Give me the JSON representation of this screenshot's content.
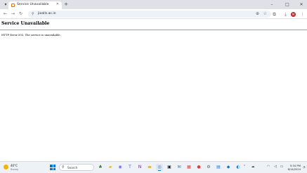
{
  "browser": {
    "tab": {
      "title": "Service Unavailable"
    },
    "address": {
      "url": "jioalls.ac.in"
    },
    "icons": {
      "tab_list": "▾",
      "tab_close": "✕",
      "new_tab": "+",
      "minimize": "–",
      "maximize": "□",
      "close": "✕",
      "back": "←",
      "forward": "→",
      "reload": "↻",
      "site_info": "⚲",
      "zoom": "⊕",
      "bookmark": "☆",
      "extensions": "⧉",
      "download": "⤓",
      "menu": "⋮"
    },
    "avatar_letter": "M"
  },
  "page": {
    "heading": "Service Unavailable",
    "message": "HTTP Error 503. The service is unavailable."
  },
  "taskbar": {
    "weather": {
      "temp": "40°C",
      "condition": "Sunny"
    },
    "search_label": "Search",
    "search_icon": "⚲",
    "apps": [
      {
        "name": "game-widget-icon",
        "glyph": "♣",
        "color": "#2e7d32"
      },
      {
        "name": "file-explorer-icon",
        "glyph": "▰",
        "color": "#f0b400"
      },
      {
        "name": "copilot-icon",
        "glyph": "◉",
        "color": "#7b61ff"
      },
      {
        "name": "teams-icon",
        "glyph": "T",
        "color": "#5b5fc7"
      },
      {
        "name": "onenote-icon",
        "glyph": "N",
        "color": "#7719aa"
      },
      {
        "name": "folder-icon",
        "glyph": "▬",
        "color": "#e8a800"
      },
      {
        "name": "chrome-icon",
        "glyph": "◎",
        "color": "#1a73e8"
      },
      {
        "name": "terminal-icon",
        "glyph": "▣",
        "color": "#202124"
      },
      {
        "name": "mail-icon",
        "glyph": "✉",
        "color": "#0078d4"
      },
      {
        "name": "store-icon",
        "glyph": "▦",
        "color": "#ea4335"
      },
      {
        "name": "opera-icon",
        "glyph": "●",
        "color": "#e53935"
      },
      {
        "name": "settings-icon",
        "glyph": "⚙",
        "color": "#5f6368"
      },
      {
        "name": "photos-icon",
        "glyph": "▤",
        "color": "#0a7cff"
      },
      {
        "name": "vscode-icon",
        "glyph": "◆",
        "color": "#007acc"
      },
      {
        "name": "edge-icon",
        "glyph": "◐",
        "color": "#0c8ad8"
      }
    ],
    "tray": {
      "chevron": "⌃",
      "cloud": "☁",
      "wifi": "◠",
      "volume": "◁",
      "battery": "▭"
    },
    "clock": {
      "time": "5:34 PM",
      "date": "6/14/2024"
    },
    "notification_icon": "◔"
  }
}
